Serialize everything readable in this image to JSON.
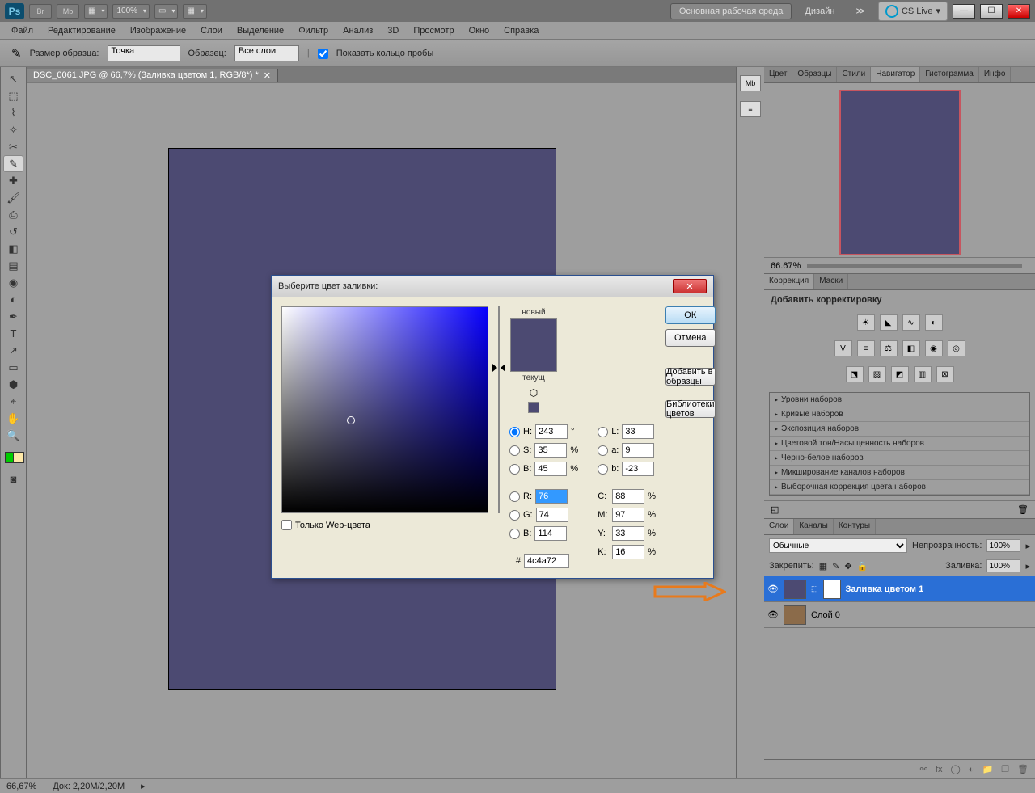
{
  "topbar": {
    "zoom": "100%",
    "workspace_active": "Основная рабочая среда",
    "workspace_other": "Дизайн",
    "cslive": "CS Live"
  },
  "menu": [
    "Файл",
    "Редактирование",
    "Изображение",
    "Слои",
    "Выделение",
    "Фильтр",
    "Анализ",
    "3D",
    "Просмотр",
    "Окно",
    "Справка"
  ],
  "options": {
    "sample_size_label": "Размер образца:",
    "sample_size_value": "Точка",
    "sample_label": "Образец:",
    "sample_value": "Все слои",
    "show_ring": "Показать кольцо пробы"
  },
  "doc": {
    "tab": "DSC_0061.JPG @ 66,7% (Заливка цветом 1, RGB/8*) *"
  },
  "status": {
    "zoom": "66,67%",
    "doc": "Док: 2,20M/2,20M"
  },
  "panels": {
    "color_tabs": [
      "Цвет",
      "Образцы",
      "Стили",
      "Навигатор",
      "Гистограмма",
      "Инфо"
    ],
    "nav_zoom": "66.67%",
    "adj_tabs": [
      "Коррекция",
      "Маски"
    ],
    "adj_header": "Добавить корректировку",
    "presets": [
      "Уровни наборов",
      "Кривые наборов",
      "Экспозиция наборов",
      "Цветовой тон/Насыщенность наборов",
      "Черно-белое наборов",
      "Микширование каналов наборов",
      "Выборочная коррекция цвета наборов"
    ],
    "layers_tabs": [
      "Слои",
      "Каналы",
      "Контуры"
    ],
    "blend_label": "Обычные",
    "opacity_label": "Непрозрачность:",
    "opacity_value": "100%",
    "lock_label": "Закрепить:",
    "fill_label": "Заливка:",
    "fill_value": "100%",
    "layers": [
      {
        "name": "Заливка цветом 1",
        "selected": true,
        "mask": true
      },
      {
        "name": "Слой 0",
        "selected": false,
        "mask": false
      }
    ]
  },
  "dialog": {
    "title": "Выберите цвет заливки:",
    "new_label": "новый",
    "current_label": "текущ",
    "ok": "ОК",
    "cancel": "Отмена",
    "add_swatch": "Добавить в образцы",
    "libraries": "Библиотеки цветов",
    "H": "243",
    "S": "35",
    "B": "45",
    "R": "76",
    "G": "74",
    "Bb": "114",
    "L": "33",
    "a": "9",
    "b": "-23",
    "C": "88",
    "M": "97",
    "Y": "33",
    "K": "16",
    "hex": "4c4a72",
    "webonly": "Только Web-цвета",
    "deg": "°",
    "pct": "%",
    "hash": "#"
  }
}
